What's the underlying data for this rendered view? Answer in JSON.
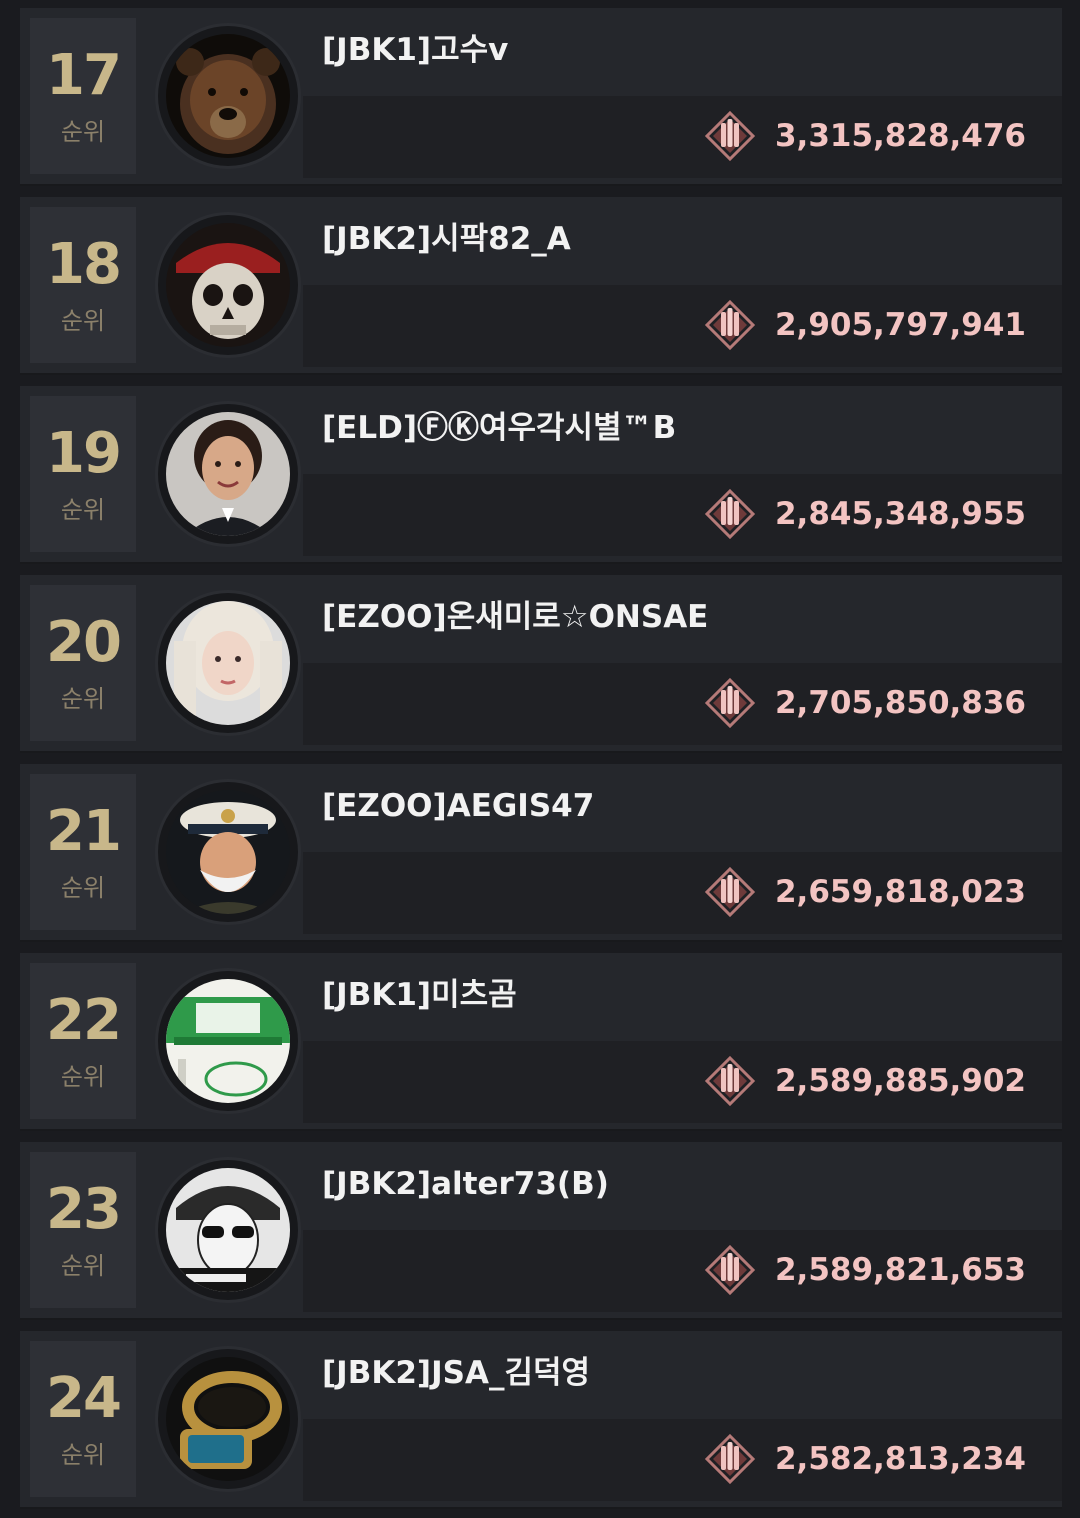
{
  "leaderboard": {
    "rank_suffix": "순위",
    "accent_color": "#c8b78a",
    "score_color": "#f3c4c2",
    "score_icon": "ammo-emblem-icon",
    "entries": [
      {
        "rank": "17",
        "name": "[JBK1]고수v",
        "score": "3,315,828,476",
        "avatar": "bear-avatar-icon"
      },
      {
        "rank": "18",
        "name": "[JBK2]시팍82_A",
        "score": "2,905,797,941",
        "avatar": "pirate-skull-avatar-icon"
      },
      {
        "rank": "19",
        "name": "[ELD]ⒻⓀ여우각시별™B",
        "score": "2,845,348,955",
        "avatar": "woman-officer-avatar-icon"
      },
      {
        "rank": "20",
        "name": "[EZOO]온새미로☆ONSAE",
        "score": "2,705,850,836",
        "avatar": "blonde-woman-avatar-icon"
      },
      {
        "rank": "21",
        "name": "[EZOO]AEGIS47",
        "score": "2,659,818,023",
        "avatar": "navy-captain-avatar-icon"
      },
      {
        "rank": "22",
        "name": "[JBK1]미츠곰",
        "score": "2,589,885,902",
        "avatar": "flour-bag-avatar-icon"
      },
      {
        "rank": "23",
        "name": "[JBK2]alter73(B)",
        "score": "2,589,821,653",
        "avatar": "sunglasses-soldier-avatar-icon"
      },
      {
        "rank": "24",
        "name": "[JBK2]JSA_김덕영",
        "score": "2,582,813,234",
        "avatar": "ring-avatar-icon"
      }
    ]
  }
}
